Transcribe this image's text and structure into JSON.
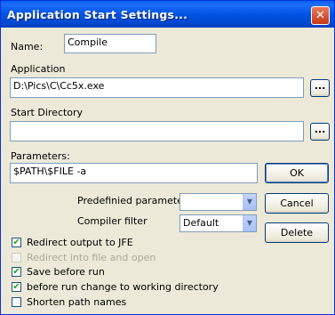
{
  "window": {
    "title": "Application Start Settings...",
    "close_glyph": "✕"
  },
  "name": {
    "label": "Name:",
    "value": "Compile"
  },
  "application": {
    "label": "Application",
    "value": "D:\\Pics\\C\\Cc5x.exe",
    "browse_label": "..."
  },
  "start_directory": {
    "label": "Start Directory",
    "value": "",
    "browse_label": "..."
  },
  "parameters": {
    "label": "Parameters:",
    "value": "$PATH\\$FILE -a"
  },
  "predefined": {
    "label": "Predefinied parameters:",
    "value": ""
  },
  "compiler_filter": {
    "label": "Compiler filter",
    "value": "Default"
  },
  "buttons": {
    "ok": "OK",
    "cancel": "Cancel",
    "delete": "Delete"
  },
  "options": [
    {
      "label": "Redirect output to JFE",
      "checked": true,
      "enabled": true,
      "mark": "✔"
    },
    {
      "label": "Redirect into file and open",
      "checked": false,
      "enabled": false,
      "mark": ""
    },
    {
      "label": "Save before run",
      "checked": true,
      "enabled": true,
      "mark": "✔"
    },
    {
      "label": "before run change to working directory",
      "checked": true,
      "enabled": true,
      "mark": "✔"
    },
    {
      "label": "Shorten path names",
      "checked": false,
      "enabled": true,
      "mark": ""
    }
  ],
  "icons": {
    "close": "close-icon",
    "dropdown": "chevron-down-icon",
    "check": "checkmark-icon"
  },
  "colors": {
    "title_bar": "#0054e3",
    "close_button": "#d7542c",
    "check_mark": "#21a121",
    "field_border": "#7f9db9",
    "dialog_bg": "#ece9d8"
  }
}
